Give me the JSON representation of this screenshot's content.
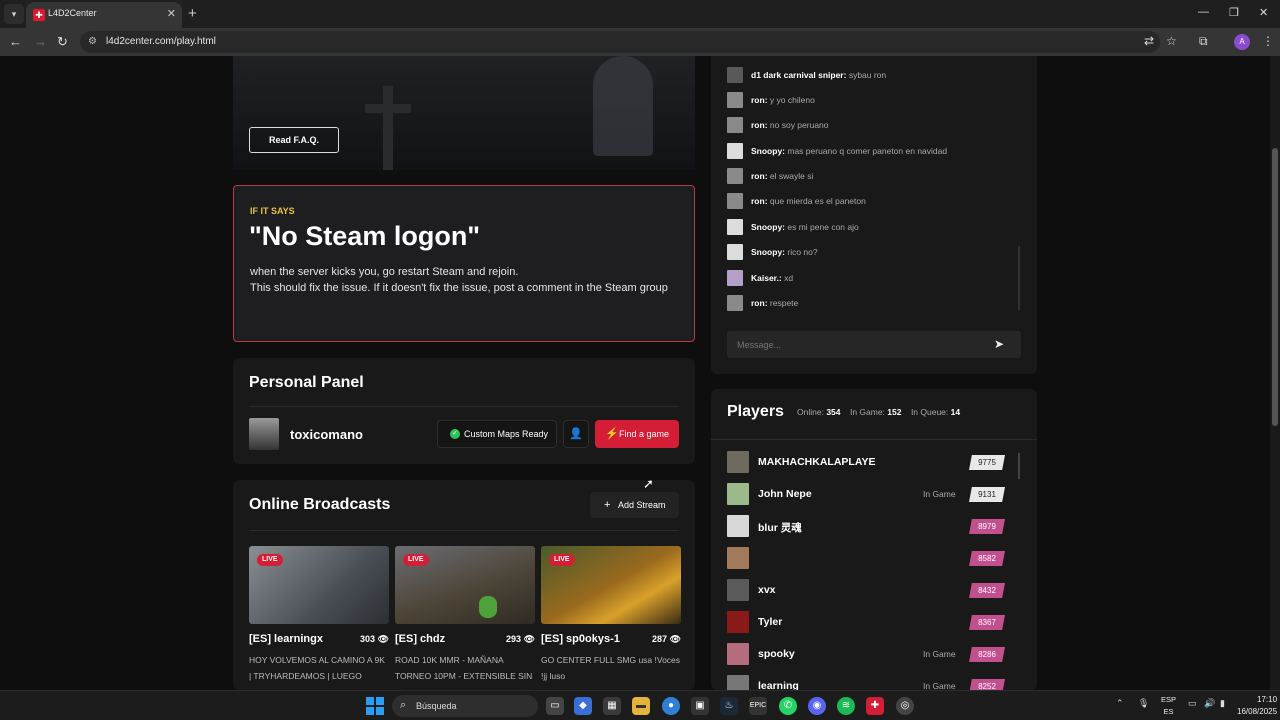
{
  "browser": {
    "tab_title": "L4D2Center",
    "url": "l4d2center.com/play.html",
    "profile_initial": "A"
  },
  "hero": {
    "faq_label": "Read F.A.Q."
  },
  "warning": {
    "tag": "IF IT SAYS",
    "title": "\"No Steam logon\"",
    "line1": "when the server kicks you, go restart Steam and rejoin.",
    "line2": "This should fix the issue. If it doesn't fix the issue, post a comment in the Steam group"
  },
  "personal_panel": {
    "title": "Personal Panel",
    "username": "toxicomano",
    "maps_label": "Custom Maps Ready",
    "find_label": "Find a game"
  },
  "broadcasts": {
    "title": "Online Broadcasts",
    "add_label": "Add Stream",
    "live_label": "LIVE",
    "streams": [
      {
        "name": "[ES] learningx",
        "views": "303",
        "desc": "HOY VOLVEMOS AL CAMINO A 9K | TRYHARDEAMOS | LUEGO"
      },
      {
        "name": "[ES] chdz",
        "views": "293",
        "desc": "ROAD 10K MMR - MAÑANA TORNEO 10PM - EXTENSIBLE SIN"
      },
      {
        "name": "[ES] sp0okys-1",
        "views": "287",
        "desc": "GO CENTER FULL SMG usa !Voces !jj luso"
      }
    ]
  },
  "chat": {
    "messages": [
      {
        "user": "d1 dark carnival sniper:",
        "text": "sybau ron"
      },
      {
        "user": "ron:",
        "text": "y yo chileno"
      },
      {
        "user": "ron:",
        "text": "no soy peruano"
      },
      {
        "user": "Snoopy:",
        "text": "mas peruano q comer paneton en navidad"
      },
      {
        "user": "ron:",
        "text": "el swayle si"
      },
      {
        "user": "ron:",
        "text": "que mierda es el paneton"
      },
      {
        "user": "Snoopy:",
        "text": "es mi pene con ajo"
      },
      {
        "user": "Snoopy:",
        "text": "rico no?"
      },
      {
        "user": "Kaiser.:",
        "text": "xd"
      },
      {
        "user": "ron:",
        "text": "respete"
      }
    ],
    "placeholder": "Message..."
  },
  "players": {
    "title": "Players",
    "online_label": "Online:",
    "online": "354",
    "ingame_label": "In Game:",
    "ingame": "152",
    "queue_label": "In Queue:",
    "queue": "14",
    "list": [
      {
        "name": "MAKHACHKALAPLAYE",
        "status": "",
        "elo": "9775"
      },
      {
        "name": "John Nepe",
        "status": "In Game",
        "elo": "9131"
      },
      {
        "name": "blur 灵魂",
        "status": "",
        "elo": "8979"
      },
      {
        "name": "",
        "status": "",
        "elo": "8582"
      },
      {
        "name": "xvx",
        "status": "",
        "elo": "8432"
      },
      {
        "name": "Tyler",
        "status": "",
        "elo": "8367"
      },
      {
        "name": "spooky",
        "status": "In Game",
        "elo": "8286"
      },
      {
        "name": "learning",
        "status": "In Game",
        "elo": "8252"
      }
    ]
  },
  "taskbar": {
    "search_label": "Búsqueda",
    "lang_top": "ESP",
    "lang_bottom": "ES",
    "time": "17:10",
    "date": "16/08/2025"
  },
  "colors": {
    "accent": "#d31e36",
    "warning_border": "#b83a45",
    "warning_tag": "#e7c23c"
  }
}
